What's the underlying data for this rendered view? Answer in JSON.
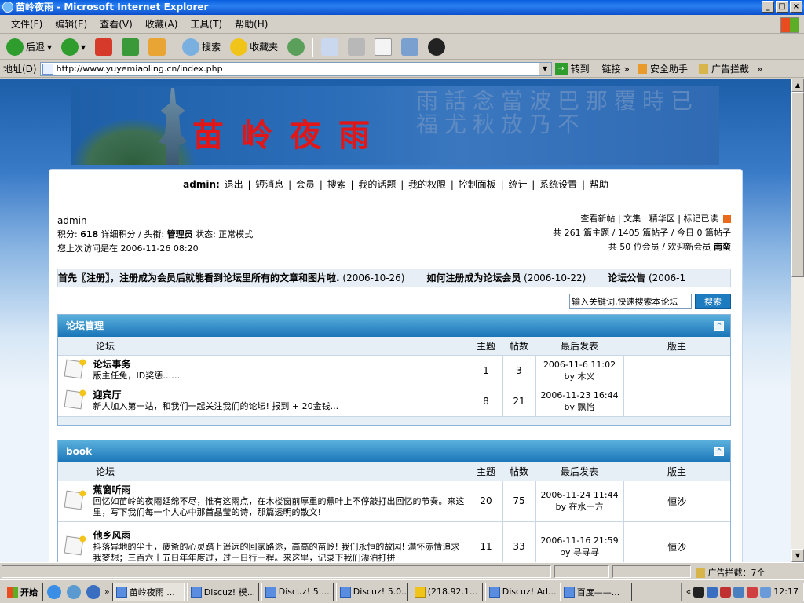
{
  "window": {
    "title": "苗岭夜雨 - Microsoft Internet Explorer"
  },
  "menu": [
    "文件(F)",
    "编辑(E)",
    "查看(V)",
    "收藏(A)",
    "工具(T)",
    "帮助(H)"
  ],
  "toolbar": {
    "back": "后退",
    "search": "搜索",
    "favorites": "收藏夹"
  },
  "address": {
    "label": "地址(D)",
    "url": "http://www.yuyemiaoling.cn/index.php",
    "go": "转到",
    "links": "链接",
    "safety": "安全助手",
    "adblock": "广告拦截"
  },
  "banner": {
    "logo": "苗岭夜雨",
    "calligraphy": "雨話念當波巴那覆時已福尤秋放乃不"
  },
  "nav": {
    "user": "admin:",
    "items": [
      "退出",
      "短消息",
      "会员",
      "搜索",
      "我的话题",
      "我的权限",
      "控制面板",
      "统计",
      "系统设置",
      "帮助"
    ]
  },
  "userinfo": {
    "name": "admin",
    "points_label": "积分:",
    "points": "618",
    "points_rest": "详细积分 / 头衔:",
    "rank": "管理员",
    "status": "状态: 正常模式",
    "lastvisit": "您上次访问是在 2006-11-26 08:20"
  },
  "rightinfo": {
    "links": [
      "查看新帖",
      "文集",
      "精华区",
      "标记已读"
    ],
    "stats": "共 261 篇主题 / 1405 篇帖子 / 今日 0 篇帖子",
    "members": "共 50 位会员 / 欢迎新会员",
    "newmember": "南蛮"
  },
  "announcements": [
    {
      "text": "首先〖注册〗，注册成为会员后就能看到论坛里所有的文章和图片啦.",
      "date": "(2006-10-26)"
    },
    {
      "text": "如何注册成为论坛会员",
      "date": "(2006-10-22)"
    },
    {
      "text": "论坛公告",
      "date": "(2006-1"
    }
  ],
  "search": {
    "placeholder": "输入关键词,快速搜索本论坛",
    "button": "搜索"
  },
  "columns": {
    "forum": "论坛",
    "topics": "主题",
    "posts": "帖数",
    "last": "最后发表",
    "mod": "版主"
  },
  "categories": [
    {
      "name": "论坛管理",
      "forums": [
        {
          "title": "论坛事务",
          "desc": "版主任免，ID奖惩……",
          "topics": "1",
          "posts": "3",
          "last_time": "2006-11-6 11:02",
          "last_by": "by 木义",
          "mod": ""
        },
        {
          "title": "迎宾厅",
          "desc": "新人加入第一站，和我们一起关注我们的论坛! 报到 + 20金钱...",
          "topics": "8",
          "posts": "21",
          "last_time": "2006-11-23 16:44",
          "last_by": "by 飘怡",
          "mod": ""
        }
      ]
    },
    {
      "name": "book",
      "forums": [
        {
          "title": "蕉窗听雨",
          "desc": "回忆如苗岭的夜雨延绵不尽，惟有这雨点，在木楼窗前厚重的蕉叶上不停敲打出回忆的节奏。来这里，写下我们每一个人心中那首晶莹的诗，那篇透明的散文!",
          "topics": "20",
          "posts": "75",
          "last_time": "2006-11-24 11:44",
          "last_by": "by 在水一方",
          "mod": "恒沙"
        },
        {
          "title": "他乡风雨",
          "desc": "抖落异地的尘土，疲惫的心灵踏上遥远的回家路途，高高的苗岭! 我们永恒的故园! 满怀赤情追求我梦想；三百六十五日年年度过，过一日行一程。来这里，记录下我们漂泊打拼",
          "topics": "11",
          "posts": "33",
          "last_time": "2006-11-16 21:59",
          "last_by": "by 寻寻寻",
          "mod": "恒沙"
        }
      ]
    }
  ],
  "statusbar": {
    "adblock": "广告拦截：7个"
  },
  "taskbar": {
    "start": "开始",
    "tasks": [
      "苗岭夜雨 ...",
      "Discuz! 模...",
      "Discuz! 5....",
      "Discuz! 5.0...",
      "(218.92.1...",
      "Discuz! Ad...",
      "百度——..."
    ],
    "time": "12:17"
  }
}
